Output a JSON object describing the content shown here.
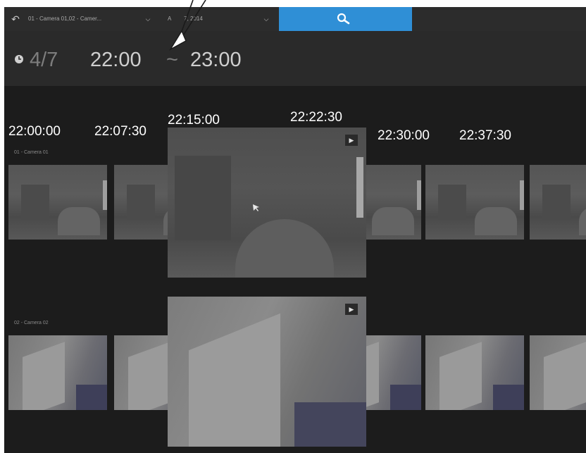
{
  "toolbar": {
    "camera_select": "01 - Camera 01,02 - Camer...",
    "date_select_prefix": "A",
    "date_select_suffix": "7, 2014"
  },
  "time_range": {
    "date": "4/7",
    "start": "22:00",
    "separator": "~",
    "end": "23:00"
  },
  "cameras": [
    {
      "label": "01 - Camera 01"
    },
    {
      "label": "02 - Camera 02"
    }
  ],
  "time_annotations": [
    {
      "text": "22:00:00"
    },
    {
      "text": "22:07:30"
    },
    {
      "text": "22:15:00"
    },
    {
      "text": "22:22:30"
    },
    {
      "text": "22:30:00"
    },
    {
      "text": "22:37:30"
    }
  ],
  "icons": {
    "back": "undo-arrow-icon",
    "chevron": "chevron-down-icon",
    "search": "search-icon",
    "clock": "clock-icon",
    "play": "play-icon",
    "cursor": "mouse-cursor-icon"
  },
  "colors": {
    "accent": "#2f8fd6",
    "background": "#1c1c1c",
    "toolbar": "#2c2c2c"
  }
}
